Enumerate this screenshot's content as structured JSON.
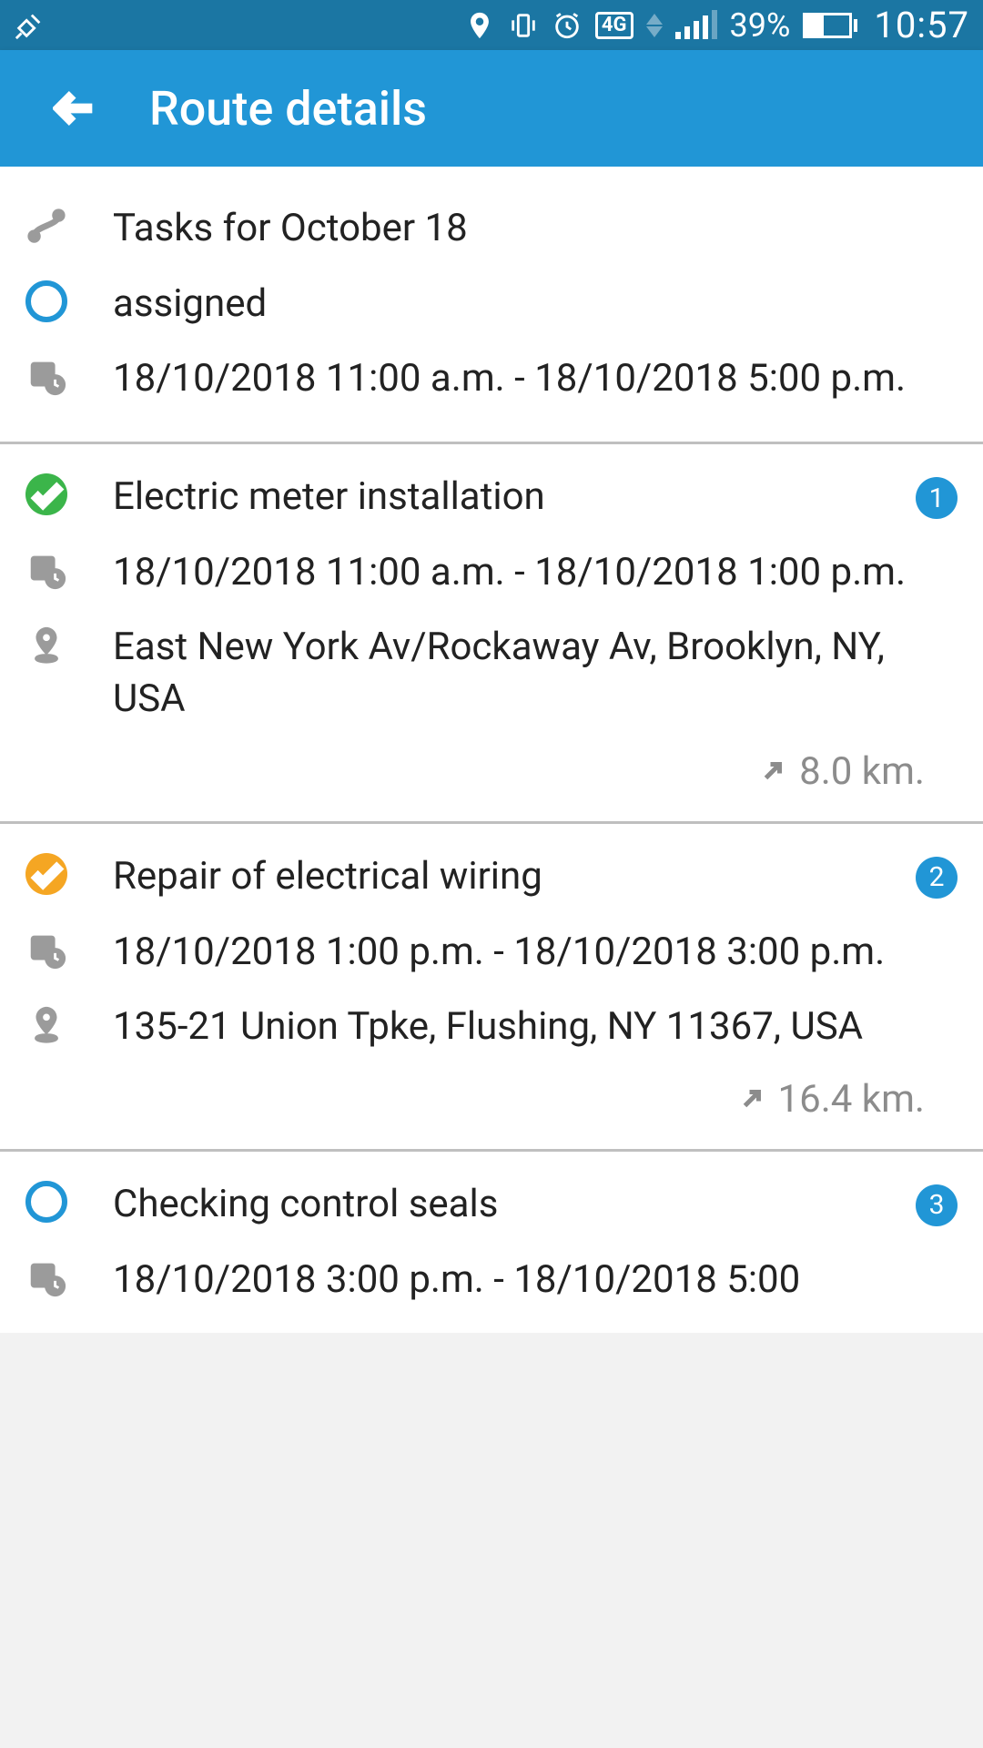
{
  "statusbar": {
    "network_label": "4G",
    "battery_pct": "39%",
    "time": "10:57"
  },
  "appbar": {
    "title": "Route details"
  },
  "header": {
    "title": "Tasks for October 18",
    "status": "assigned",
    "range": "18/10/2018 11:00 a.m. - 18/10/2018 5:00 p.m."
  },
  "tasks": [
    {
      "title": "Electric meter installation",
      "num": "1",
      "status_color": "green",
      "time": "18/10/2018 11:00 a.m. - 18/10/2018 1:00 p.m.",
      "address": "East New York Av/Rockaway Av, Brooklyn, NY, USA",
      "distance": "8.0 km."
    },
    {
      "title": "Repair of electrical wiring",
      "num": "2",
      "status_color": "amber",
      "time": "18/10/2018 1:00 p.m. - 18/10/2018 3:00 p.m.",
      "address": "135-21 Union Tpke, Flushing, NY 11367, USA",
      "distance": "16.4 km."
    },
    {
      "title": "Checking control seals",
      "num": "3",
      "status_color": "empty",
      "time": "18/10/2018 3:00 p.m. - 18/10/2018 5:00",
      "address": "",
      "distance": ""
    }
  ]
}
